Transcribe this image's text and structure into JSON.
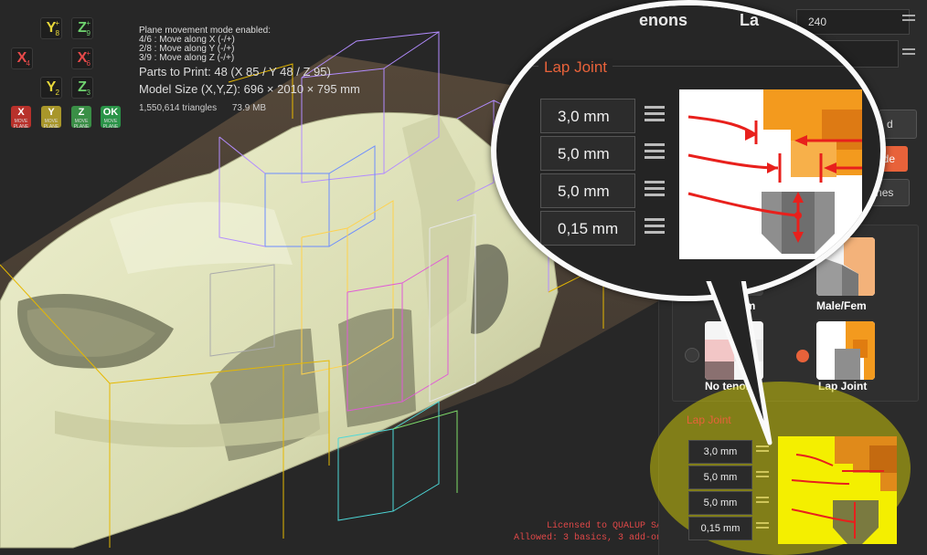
{
  "axis_buttons": {
    "y_top": {
      "letter": "Y",
      "sup": "+",
      "sub": "8"
    },
    "z_top": {
      "letter": "Z",
      "sup": "+",
      "sub": "9"
    },
    "x_left": {
      "letter": "X",
      "sub": "4"
    },
    "x_right": {
      "letter": "X",
      "sup": "+",
      "sub": "6"
    },
    "y_bottom": {
      "letter": "Y",
      "sub": "2"
    },
    "z_bottom": {
      "letter": "Z",
      "sub": "3"
    }
  },
  "plane_buttons": [
    {
      "letter": "X",
      "caption": "MOVE PLANE",
      "color": "#c0392b"
    },
    {
      "letter": "Y",
      "caption": "MOVE PLANE",
      "color": "#b7a52c"
    },
    {
      "letter": "Z",
      "caption": "MOVE PLANE",
      "color": "#3e9a4a"
    },
    {
      "letter": "OK",
      "caption": "MOVE PLANE",
      "color": "#2e9a4a"
    }
  ],
  "info": {
    "mode_line": "Plane movement mode enabled:",
    "move_x": "4/6 : Move along X (-/+)",
    "move_y": "2/8 : Move along Y (-/+)",
    "move_z": "3/9 : Move along Z (-/+)",
    "parts": "Parts to Print: 48 (X 85 / Y 48 / Z 95)",
    "model_size": "Model Size (X,Y,Z): 696 × 2010 × 795 mm",
    "triangles": "1,550,614 triangles",
    "memory": "73.9 MB"
  },
  "license": {
    "line1": "Licensed to QUALUP SAS",
    "line2": "Allowed: 3 basics, 3 add-ons"
  },
  "panel": {
    "top_value": "240",
    "header_fragment": "enons",
    "header_fragment2": "La",
    "btn_fragment_d": "d",
    "btn_fragment_side": "side",
    "btn_fragment_planes": "planes",
    "options": [
      {
        "label": "Male/Fem",
        "selected": false
      },
      {
        "label": "No tenon",
        "selected": false
      },
      {
        "label": "Lap Joint",
        "selected": true
      },
      {
        "label": "em",
        "selected": false
      }
    ],
    "lap_joint": {
      "title": "Lap Joint",
      "values": [
        "3,0 mm",
        "5,0 mm",
        "5,0 mm",
        "0,15 mm"
      ]
    }
  },
  "magnifier": {
    "header_fragment": "enons",
    "header_fragment2": "La",
    "title": "Lap Joint",
    "values": [
      "3,0 mm",
      "5,0 mm",
      "5,0 mm",
      "0,15 mm"
    ]
  },
  "colors": {
    "accent": "#e8623a",
    "highlight": "#c9c40a",
    "model": "#e4e6c0",
    "arrow": "#e8201c",
    "orange_part": "#f39a1e",
    "grey_part": "#8e8e8e"
  }
}
